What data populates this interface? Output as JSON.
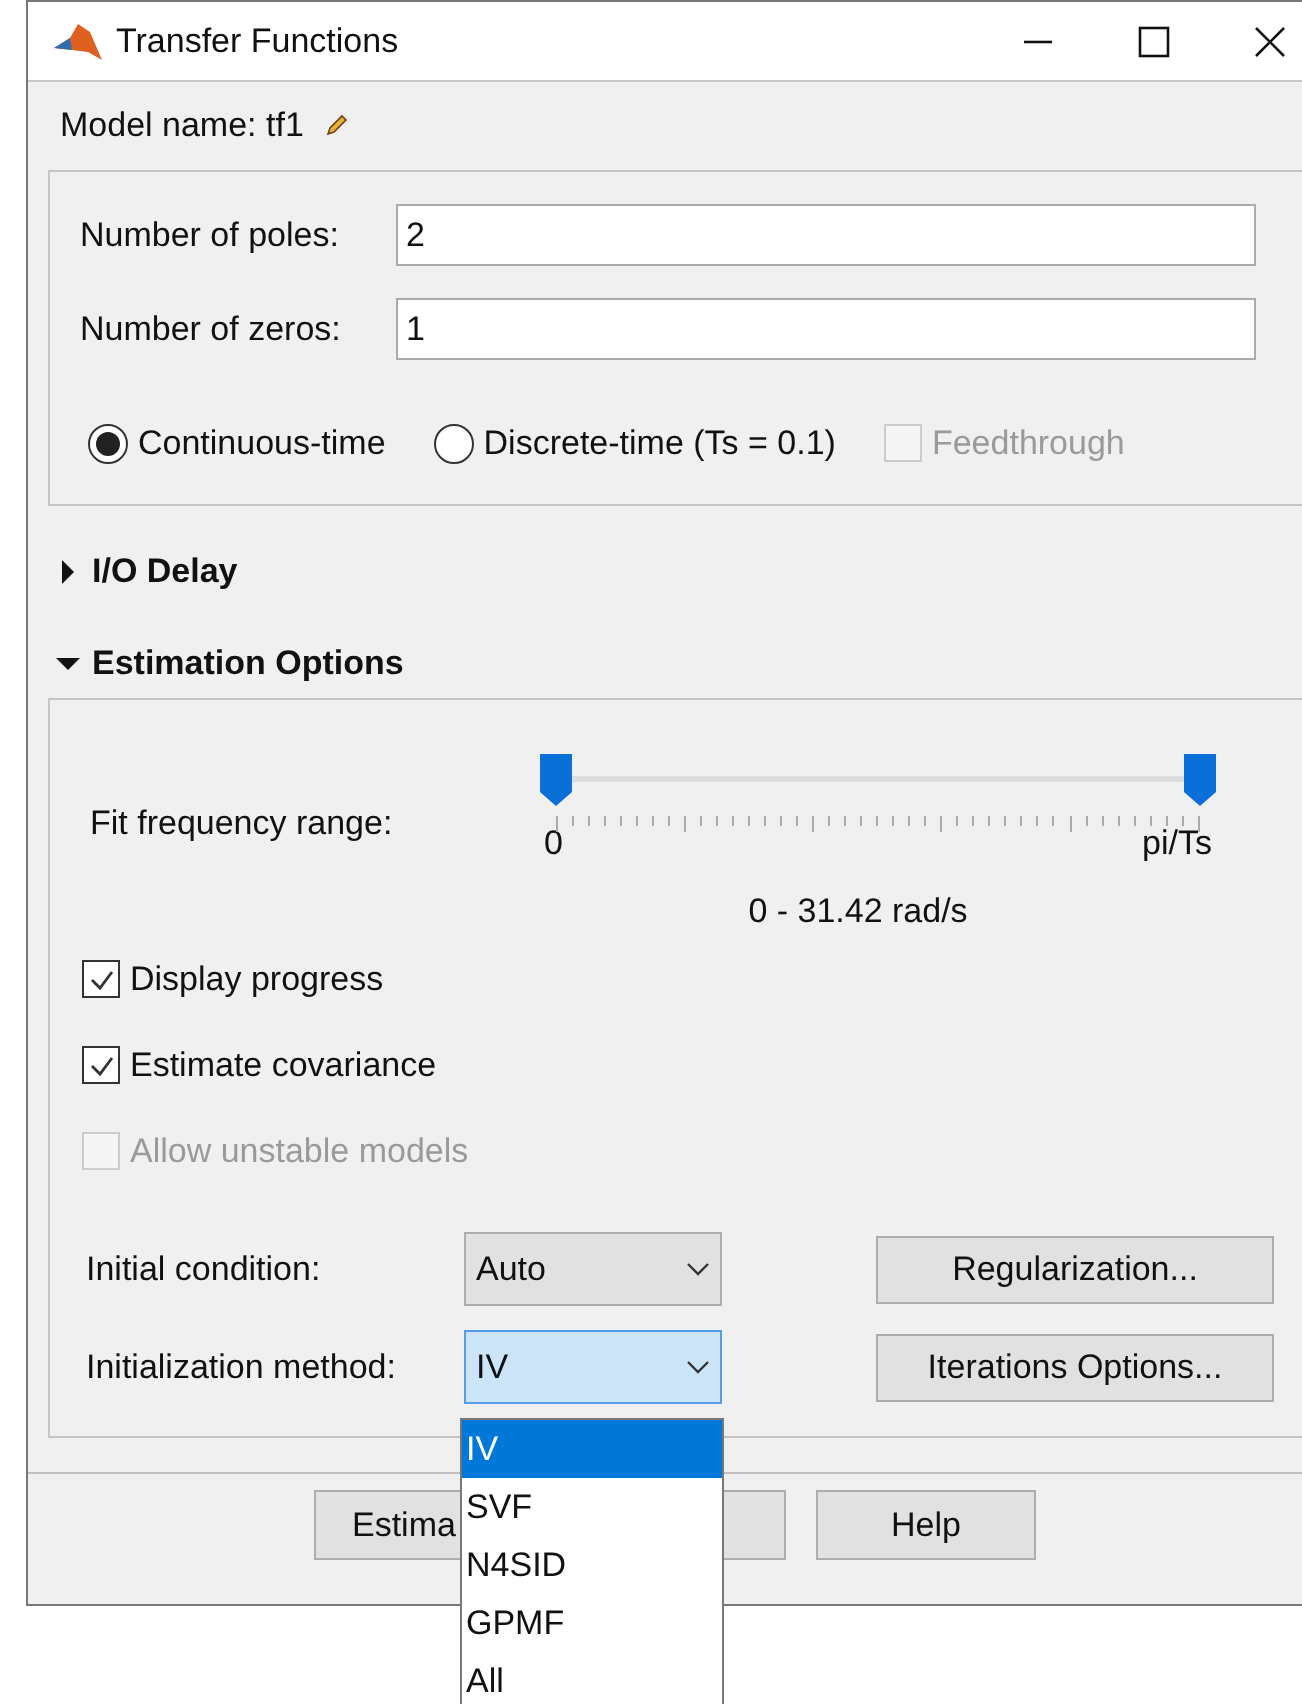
{
  "window": {
    "title": "Transfer Functions"
  },
  "model_name": "Model name: tf1",
  "fields": [
    {
      "label": "Number of poles:",
      "value": "2"
    },
    {
      "label": "Number of zeros:",
      "value": "1"
    }
  ],
  "time_options": [
    {
      "kind": "radio",
      "label": "Continuous-time",
      "selected": true,
      "disabled": false
    },
    {
      "kind": "radio",
      "label": "Discrete-time (Ts = 0.1)",
      "selected": false,
      "disabled": false
    },
    {
      "kind": "checkbox",
      "label": "Feedthrough",
      "checked": false,
      "disabled": true
    }
  ],
  "sections": [
    {
      "label": "I/O Delay",
      "expanded": false
    },
    {
      "label": "Estimation Options",
      "expanded": true
    }
  ],
  "frequency": {
    "label": "Fit frequency range:",
    "thumbs": [
      {
        "level": 0
      },
      {
        "level": 1
      }
    ],
    "min_label": "0",
    "max_label": "pi/Ts",
    "reading": "0 - 31.42 rad/s"
  },
  "checkboxes": [
    {
      "label": "Display progress",
      "checked": true,
      "disabled": false
    },
    {
      "label": "Estimate covariance",
      "checked": true,
      "disabled": false
    },
    {
      "label": "Allow unstable models",
      "checked": false,
      "disabled": true
    }
  ],
  "combos": [
    {
      "label": "Initial condition:",
      "value": "Auto",
      "focused": false,
      "button": "Regularization..."
    },
    {
      "label": "Initialization method:",
      "value": "IV",
      "focused": true,
      "button": "Iterations Options..."
    }
  ],
  "footer_buttons": [
    "Estima",
    "Help"
  ],
  "dropdown": [
    {
      "label": "IV",
      "selected": true
    },
    {
      "label": "SVF",
      "selected": false
    },
    {
      "label": "N4SID",
      "selected": false
    },
    {
      "label": "GPMF",
      "selected": false
    },
    {
      "label": "All",
      "selected": false
    }
  ]
}
